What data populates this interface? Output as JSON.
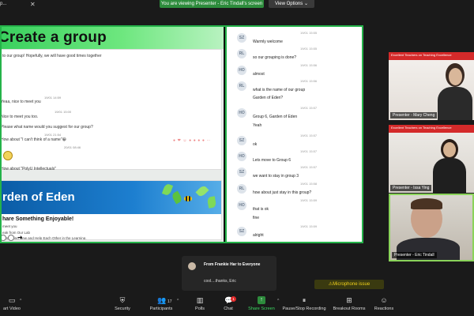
{
  "topbar": {
    "left_label": "p...",
    "viewing_banner": "You are viewing Presenter - Eric Tindall's screen",
    "view_options": "View Options ⌄"
  },
  "slide": {
    "title": "Create a group",
    "post1_lines": [
      "to our group! Hopefully, we will have good times together",
      "Yeaa, nice to meet you",
      "Nice to meet you too.",
      "Please what name would you suggest for our group?",
      "How about \"I can't think of a name\"😁",
      "How about \"PolyU Intellectuals\""
    ],
    "post1_times": [
      "19/01 14:59",
      "19/01 15:00",
      "19/01 21:54",
      "20/01 08:46"
    ],
    "eden_title": "rden of Eden",
    "eden_subtitle": "hare Something Enjoyable!",
    "eden_lines": [
      "meet you",
      "eak from Our Lab",
      "something New and Help Each Other in the Learning."
    ]
  },
  "chat": {
    "messages": [
      {
        "avatar": "SZ",
        "time": "19/01 15:55",
        "text": "Warmly welcome"
      },
      {
        "avatar": "RL",
        "time": "19/01 15:55",
        "text": "so our grouping is done?"
      },
      {
        "avatar": "HO",
        "time": "19/01 15:56",
        "text": "almost"
      },
      {
        "avatar": "RL",
        "time": "19/01 15:56",
        "text": "what is the name of our group"
      },
      {
        "avatar": "",
        "time": "",
        "text": "Garden of Eden?"
      },
      {
        "avatar": "HO",
        "time": "19/01 15:57",
        "text": "Group 6, Garden of Eden"
      },
      {
        "avatar": "",
        "time": "",
        "text": "Yeah"
      },
      {
        "avatar": "SZ",
        "time": "19/01 15:57",
        "text": "ok"
      },
      {
        "avatar": "HO",
        "time": "19/01 15:57",
        "text": "Lets move to Group 6"
      },
      {
        "avatar": "SZ",
        "time": "19/01 15:57",
        "text": "we want to stay in group 3"
      },
      {
        "avatar": "RL",
        "time": "19/01 15:58",
        "text": "how about just stay in this group?"
      },
      {
        "avatar": "HO",
        "time": "19/01 15:59",
        "text": "that is ok"
      },
      {
        "avatar": "",
        "time": "",
        "text": "fine"
      },
      {
        "avatar": "SZ",
        "time": "19/01 15:59",
        "text": "alright"
      }
    ]
  },
  "videos": [
    {
      "name": "Presenter - Mary Cheng",
      "banner": "Excellent Teachers on Teaching Excellence"
    },
    {
      "name": "Presenter - Issa Ying",
      "banner": "Excellent Teachers on Teaching Excellence"
    },
    {
      "name": "Presenter - Eric Tindall",
      "banner": ""
    }
  ],
  "popup": {
    "from": "From Frankie Har to Everyone",
    "message": "cool....thanks, Eric"
  },
  "mic_issue": "⚠Microphone issue",
  "toolbar": {
    "start_video": "art Video",
    "security": "Security",
    "participants": "Participants",
    "participants_count": "17",
    "polls": "Polls",
    "chat": "Chat",
    "chat_badge": "1",
    "share_screen": "Share Screen",
    "recording": "Pause/Stop Recording",
    "breakout": "Breakout Rooms",
    "reactions": "Reactions"
  },
  "colors": {
    "zoom_green": "#25b34a",
    "toolbar_bg": "#1a1a1a",
    "badge_red": "#e02828",
    "warning_yellow": "#f3d31a"
  }
}
